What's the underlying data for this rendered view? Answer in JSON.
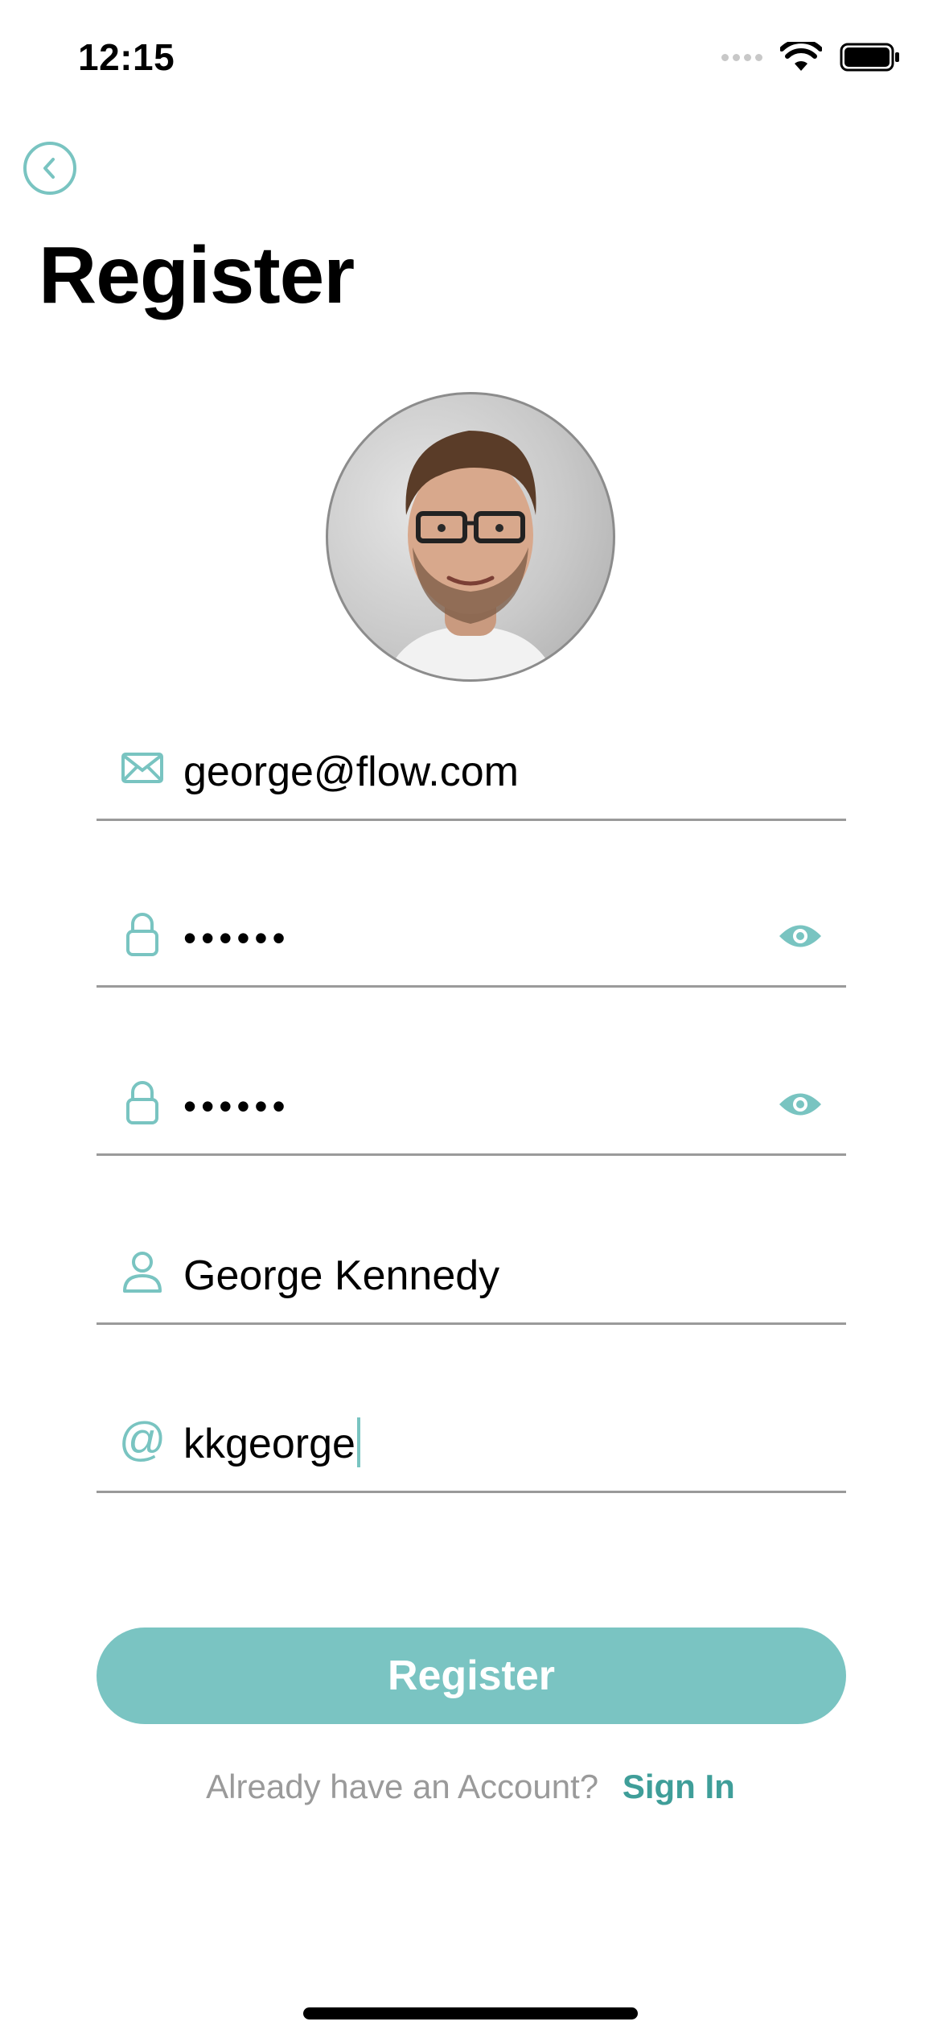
{
  "status_bar": {
    "time": "12:15"
  },
  "header": {
    "title": "Register",
    "back_icon": "chevron-left-icon"
  },
  "avatar": {
    "description": "profile-photo"
  },
  "form": {
    "email": {
      "value": "george@flow.com",
      "icon": "envelope-icon"
    },
    "password": {
      "value": "••••••",
      "icon": "lock-icon",
      "toggle_icon": "eye-icon"
    },
    "confirm_password": {
      "value": "••••••",
      "icon": "lock-icon",
      "toggle_icon": "eye-icon"
    },
    "full_name": {
      "value": "George Kennedy",
      "icon": "user-icon"
    },
    "username": {
      "value": "kkgeorge",
      "icon": "at-icon"
    }
  },
  "actions": {
    "register_label": "Register",
    "signin_prompt": "Already have an Account?",
    "signin_link": "Sign In"
  },
  "colors": {
    "accent": "#79c4c1",
    "button": "#7ac4c2",
    "link": "#3f9e99",
    "muted": "#9a9a9a"
  }
}
